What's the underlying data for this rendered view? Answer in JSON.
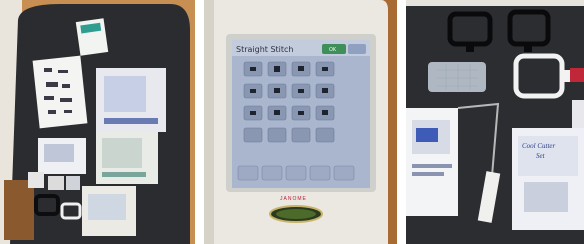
{
  "photos": [
    {
      "subject": "embroidery-accessories-on-table"
    },
    {
      "subject": "sewing-machine-touchscreen"
    },
    {
      "subject": "embroidery-hoops-and-boxes"
    }
  ],
  "screen": {
    "title": "Straight Stitch",
    "ok_label": "OK",
    "brand": "JANOME"
  },
  "box_label": {
    "line1": "Cool Cutter",
    "line2": "Set"
  },
  "colors": {
    "table": "#2b2c30",
    "floor": "#b77a3e",
    "machine": "#e9e6de",
    "screen": "#aeb9ce",
    "accent_red": "#c0283a"
  }
}
